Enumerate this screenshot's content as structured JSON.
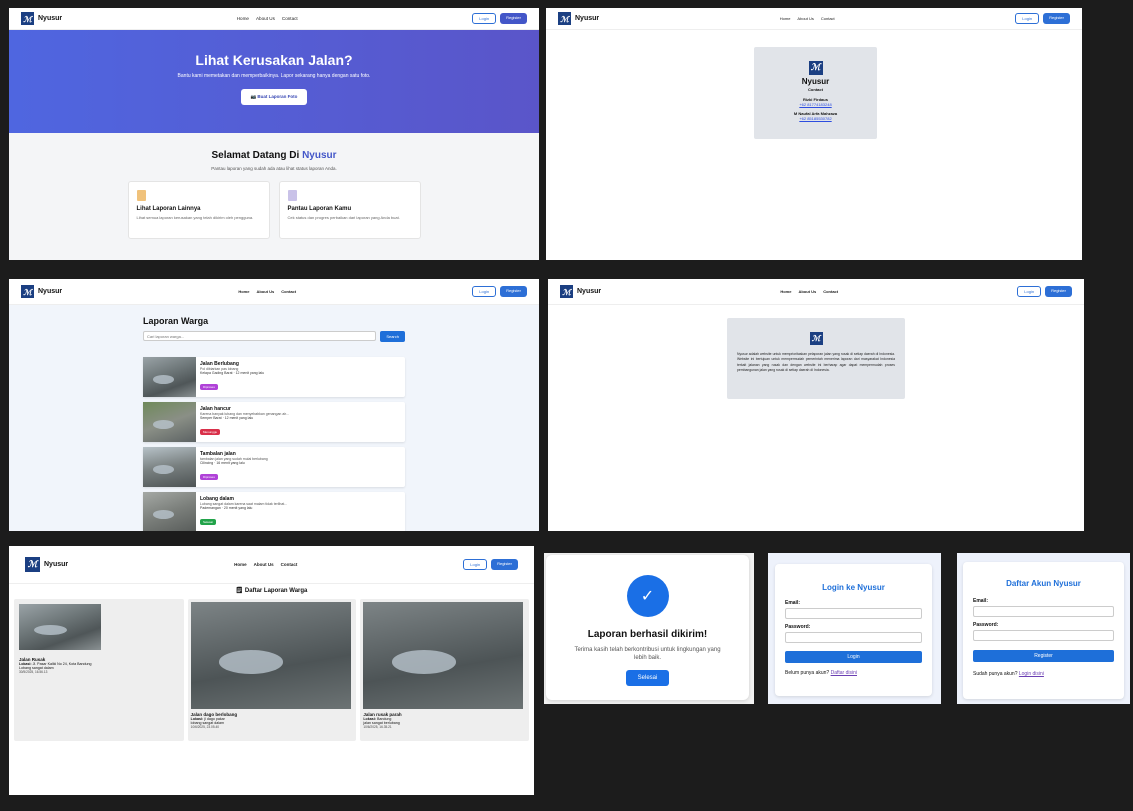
{
  "brand": "Nyusur",
  "nav": {
    "home": "Home",
    "about": "About Us",
    "contact": "Contact",
    "login": "Login",
    "register": "Register"
  },
  "home": {
    "hero_title": "Lihat Kerusakan Jalan?",
    "hero_sub": "Bantu kami memetakan dan memperbaikinya. Lapor sekarang hanya dengan satu foto.",
    "hero_button": "📷 Buat Laporan Foto",
    "welcome_prefix": "Selamat Datang Di",
    "welcome_brand": "Nyusur",
    "welcome_sub": "Pantau laporan yang sudah ada atau lihat status laporan Anda.",
    "cards": [
      {
        "title": "Lihat Laporan Lainnya",
        "desc": "Lihat semua laporan kerusakan yang telah dikirim oleh pengguna."
      },
      {
        "title": "Pantau Laporan Kamu",
        "desc": "Cek status dan progres perbaikan dari laporan yang Anda buat."
      }
    ]
  },
  "contact": {
    "title": "Nyusur",
    "subtitle": "Contact",
    "people": [
      {
        "name": "Rizki Firdaus",
        "phone": "+62 81774183248"
      },
      {
        "name": "M Naufal Arfa Mahzaza",
        "phone": "+62 85185530782"
      }
    ]
  },
  "laporan": {
    "title": "Laporan Warga",
    "search_placeholder": "Cari laporan warga...",
    "search_button": "Search",
    "items": [
      {
        "title": "Jalan Berlubang",
        "desc": "Pol dibiarkan pas lobang",
        "loc": "Kelapa Gading Barat · 12 menit yang lalu",
        "status": "Diproses",
        "color": "#b042d8"
      },
      {
        "title": "Jalan hancur",
        "desc": "Karena banyak lubang dan menyebabkan genangan air...",
        "loc": "Semper Barat · 12 menit yang lalu",
        "status": "Menunggu",
        "color": "#d9304a"
      },
      {
        "title": "Tambalan jalan",
        "desc": "tambalan jalan yang sudah mulai berlubang",
        "loc": "Cilincing · 16 menit yang lalu",
        "status": "Diproses",
        "color": "#b042d8"
      },
      {
        "title": "Lobang dalam",
        "desc": "Lubang sangat dalam karena saat malam tidak terlihat...",
        "loc": "Pademangan · 20 menit yang lalu",
        "status": "Selesai",
        "color": "#22a34a"
      }
    ]
  },
  "about": {
    "text": "Nyusur adalah website untuk memprioritaskan pelaporan jalan yang rusak di setiap daerah di Indonesia. Website ini bertujuan untuk mempermudah pemerintah menerima laporan dari masyarakat Indonesia terkait jalanan yang rusak dan dengan website ini berharap agar dapat mempermudah proses pembangunan jalan yang rusak di setiap daerah di Indonesia."
  },
  "daftar": {
    "title": "🗒 Daftar Laporan Warga",
    "loc_label": "Lokasi:",
    "items": [
      {
        "title": "Jalan Rusak",
        "loc": "Jl. Pasar Kaliki No 24, Kota Bandung",
        "desc": "Lobang sangat dalam",
        "date": "30/5/2025, 16.56.13"
      },
      {
        "title": "Jalan dago berlobang",
        "loc": "jl dago pakar",
        "desc": "lobang sangat dalam",
        "date": "10/6/2025, 23.05.40"
      },
      {
        "title": "Jalan rusak parah",
        "loc": "Bandung",
        "desc": "jalan sangat berlubang",
        "date": "10/6/2025, 16.35.21"
      }
    ]
  },
  "success": {
    "title": "Laporan berhasil dikirim!",
    "text": "Terima kasih telah berkontribusi untuk lingkungan yang lebih baik.",
    "button": "Selesai"
  },
  "login": {
    "title": "Login ke Nyusur",
    "email": "Email:",
    "password": "Password:",
    "button": "Login",
    "footer": "Belum punya akun?",
    "link": "Daftar disini"
  },
  "register": {
    "title": "Daftar Akun Nyusur",
    "email": "Email:",
    "password": "Password:",
    "button": "Register",
    "footer": "Sudah punya akun?",
    "link": "Login disini"
  }
}
